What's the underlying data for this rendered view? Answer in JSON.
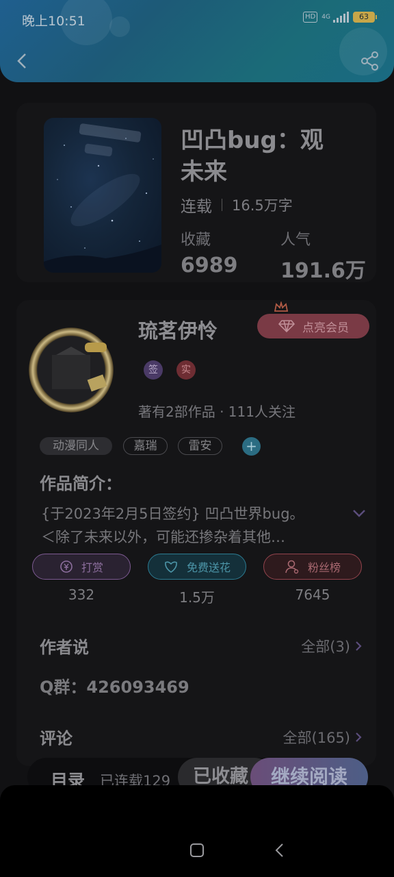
{
  "status_bar": {
    "time": "晚上10:51",
    "hd": "HD",
    "network": "4G",
    "battery": "63"
  },
  "header": {
    "back_icon": "chevron-left-icon",
    "share_icon": "share-icon"
  },
  "book": {
    "title": "凹凸bug：观未来",
    "status": "连载",
    "word_count": "16.5万字",
    "favorites_label": "收藏",
    "favorites_value": "6989",
    "popularity_label": "人气",
    "popularity_value": "191.6万"
  },
  "author": {
    "name": "琉茗伊怜",
    "vip_button": "点亮会员",
    "badge_sign": "签",
    "badge_real": "实",
    "works_info": "著有2部作品 · 111人关注"
  },
  "tags": [
    "动漫同人",
    "嘉瑞",
    "雷安"
  ],
  "intro": {
    "title": "作品简介：",
    "line1": "{于2023年2月5日签约} 凹凸世界bug。",
    "line2": "＜除了未来以外，可能还掺杂着其他…"
  },
  "actions": [
    {
      "label": "打赏",
      "value": "332",
      "color": "#7d5a92"
    },
    {
      "label": "免费送花",
      "value": "1.5万",
      "color": "#2c7c92"
    },
    {
      "label": "粉丝榜",
      "value": "7645",
      "color": "#93444d"
    }
  ],
  "author_says": {
    "title": "作者说",
    "more": "全部(3)",
    "content": "Q群：426093469"
  },
  "comments": {
    "title": "评论",
    "more": "全部(165)"
  },
  "bottom_bar": {
    "toc": "目录",
    "chapters": "已连载129",
    "collected": "已收藏",
    "continue": "继续阅读"
  },
  "accent_colors": {
    "header": "#1f5f8e",
    "vip": "#7a3a45",
    "continue": "#6a4d78"
  }
}
